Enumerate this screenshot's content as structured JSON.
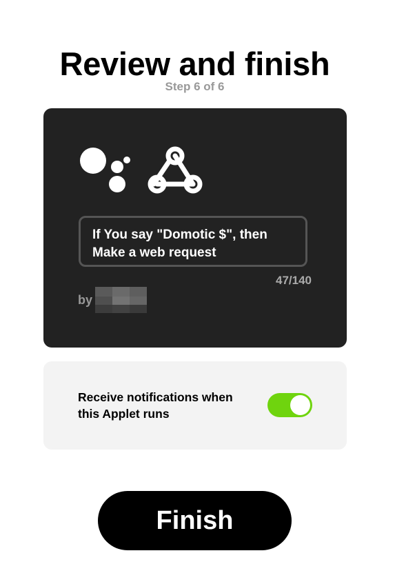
{
  "header": {
    "title": "Review and finish",
    "step": "Step 6 of 6"
  },
  "applet": {
    "icons": [
      "google-assistant-icon",
      "webhooks-icon"
    ],
    "description": "If You say \"Domotic $\", then Make a web request",
    "char_count": "47/140",
    "by_label": "by"
  },
  "notifications": {
    "label": "Receive notifications when this Applet runs",
    "enabled": true,
    "toggle_color": "#6fd40e"
  },
  "actions": {
    "finish_label": "Finish"
  },
  "colors": {
    "card_background": "#222222",
    "notify_background": "#f3f3f3",
    "button_background": "#000000"
  }
}
